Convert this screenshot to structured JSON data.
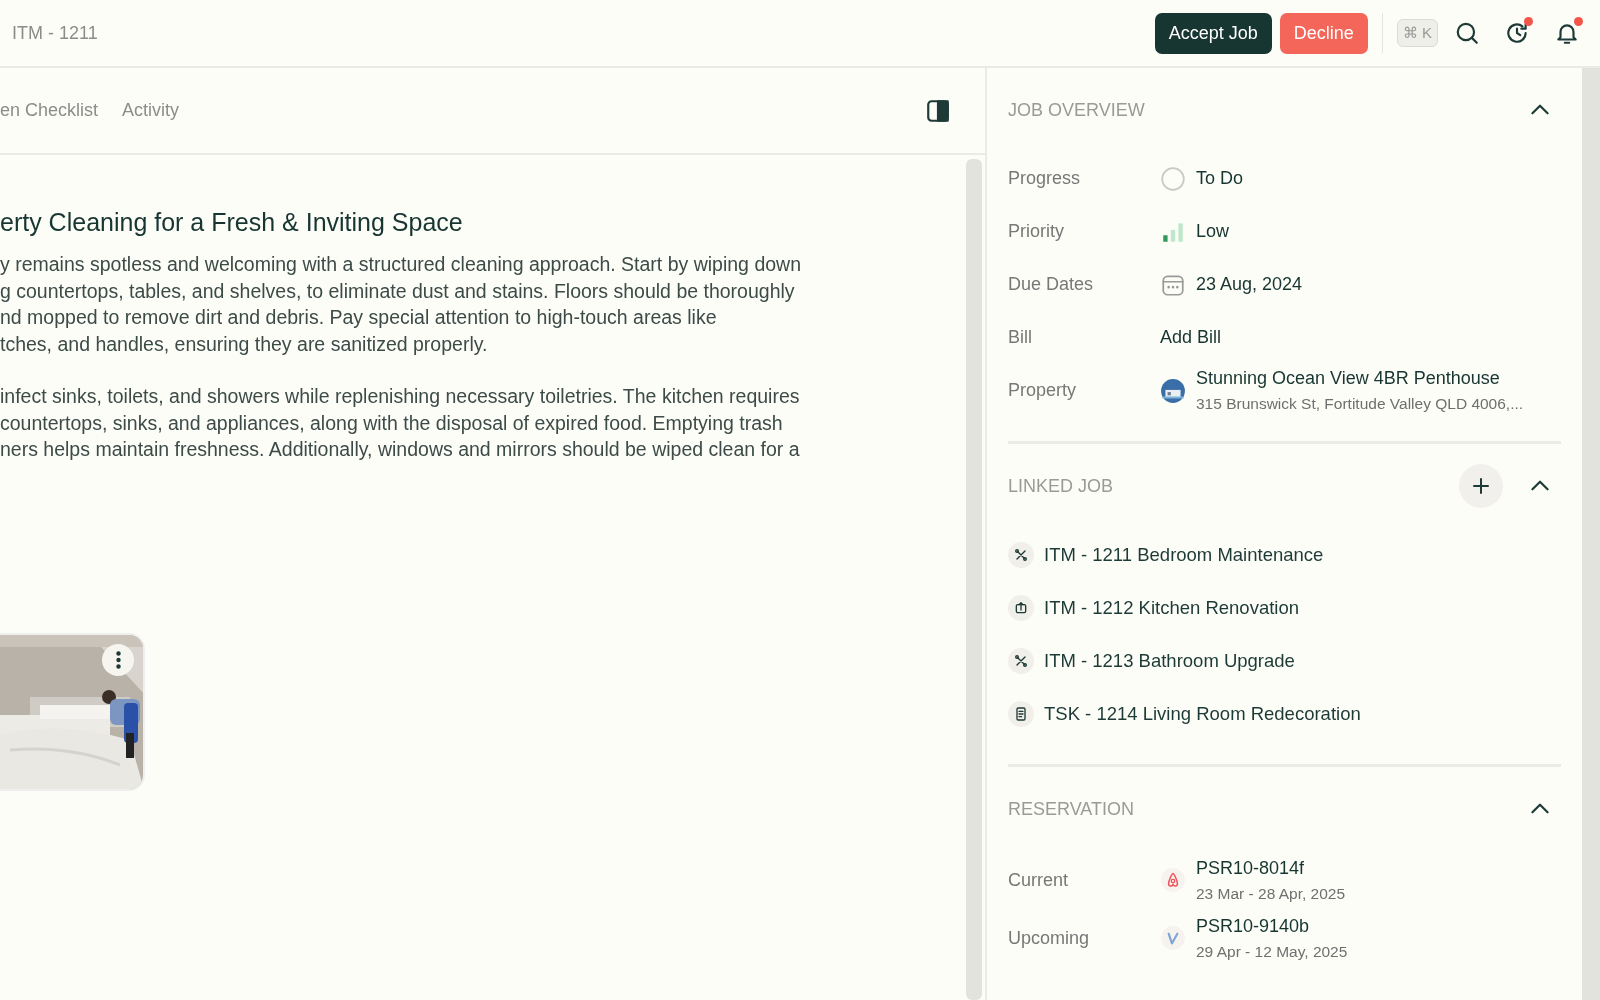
{
  "header": {
    "title": "ITM - 1211",
    "buttons": [
      {
        "label": "Accept Job",
        "kind": "accept"
      },
      {
        "label": "Decline",
        "kind": "decline"
      }
    ],
    "shortcut": "⌘ K",
    "alerts": [
      {
        "kind": "history",
        "unread": true
      },
      {
        "kind": "bell",
        "unread": true
      }
    ]
  },
  "tabs": [
    {
      "label": "en Checklist",
      "selected": false
    },
    {
      "label": "Activity",
      "selected": false
    }
  ],
  "content": {
    "title": "erty Cleaning for a Fresh & Inviting Space",
    "paragraphs": [
      [
        "y remains spotless and welcoming with a structured cleaning approach. Start by wiping down",
        "g countertops, tables, and shelves, to eliminate dust and stains. Floors should be thoroughly",
        "nd mopped to remove dirt and debris. Pay special attention to high-touch areas like",
        "tches, and handles, ensuring they are sanitized properly."
      ],
      [
        "infect sinks, toilets, and showers while replenishing necessary toiletries. The kitchen requires",
        "countertops, sinks, and appliances, along with the disposal of expired food. Emptying trash",
        "ners helps maintain freshness. Additionally, windows and mirrors should be wiped clean for a"
      ]
    ],
    "attachment": {
      "kind": "picture"
    }
  },
  "job_overview": {
    "title": "JOB OVERVIEW",
    "expanded": true,
    "fields": [
      {
        "label": "Progress",
        "kind": "status",
        "value": "To Do"
      },
      {
        "label": "Priority",
        "kind": "priority",
        "value": "Low"
      },
      {
        "label": "Due Dates",
        "kind": "date",
        "value": "23 Aug, 2024"
      },
      {
        "label": "Bill",
        "kind": "link",
        "value": "Add Bill"
      },
      {
        "label": "Property",
        "kind": "property",
        "value": "Stunning Ocean View 4BR Penthouse",
        "detail": "315 Brunswick St, Fortitude Valley QLD 4006,..."
      }
    ]
  },
  "linked_job": {
    "title": "LINKED JOB",
    "expanded": true,
    "items": [
      {
        "label": "ITM - 1211 Bedroom Maintenance",
        "kind": "tools"
      },
      {
        "label": "ITM - 1212 Kitchen Renovation",
        "kind": "upload"
      },
      {
        "label": "ITM - 1213 Bathroom Upgrade",
        "kind": "tools"
      },
      {
        "label": "TSK - 1214 Living Room Redecoration",
        "kind": "task"
      }
    ]
  },
  "reservation": {
    "title": "RESERVATION",
    "expanded": true,
    "items": [
      {
        "label": "Current",
        "kind": "airbnb",
        "code": "PSR10-8014f",
        "dates": "23 Mar - 28 Apr, 2025"
      },
      {
        "label": "Upcoming",
        "kind": "vrbo",
        "code": "PSR10-9140b",
        "dates": "29 Apr - 12 May, 2025"
      }
    ]
  }
}
